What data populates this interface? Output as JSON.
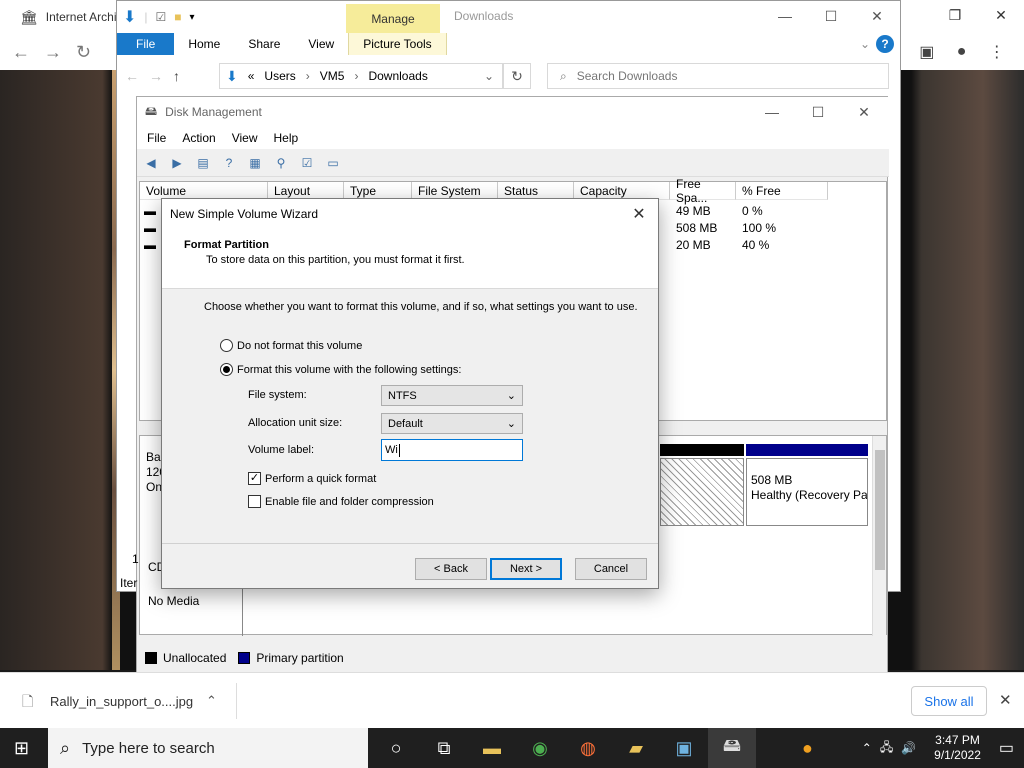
{
  "browser": {
    "tab_title": "Internet Archi",
    "download_file": "Rally_in_support_o....jpg",
    "show_all": "Show all"
  },
  "explorer": {
    "manage_tab": "Manage",
    "title": "Downloads",
    "ribbon_tabs": [
      "File",
      "Home",
      "Share",
      "View",
      "Picture Tools"
    ],
    "breadcrumb": [
      "Users",
      "VM5",
      "Downloads"
    ],
    "breadcrumb_prefix": "«",
    "search_placeholder": "Search Downloads"
  },
  "disk_mgmt": {
    "title": "Disk Management",
    "menu": [
      "File",
      "Action",
      "View",
      "Help"
    ],
    "columns": [
      "Volume",
      "Layout",
      "Type",
      "File System",
      "Status",
      "Capacity",
      "Free Spa...",
      "% Free"
    ],
    "rows": [
      {
        "free": "49 MB",
        "pct": "0 %"
      },
      {
        "free": "508 MB",
        "pct": "100 %"
      },
      {
        "free": "20 MB",
        "pct": "40 %"
      }
    ],
    "disk0_lines": [
      "Bas",
      "120",
      "On"
    ],
    "cd_label": "CD",
    "no_media": "No Media",
    "partial_1": "1",
    "partial_iter": "Iter",
    "recovery_size": "508 MB",
    "recovery_status": "Healthy (Recovery Pa",
    "legend_unallocated": "Unallocated",
    "legend_primary": "Primary partition",
    "colors": {
      "unallocated": "#000000",
      "primary": "#00008b"
    }
  },
  "wizard": {
    "title": "New Simple Volume Wizard",
    "heading": "Format Partition",
    "subheading": "To store data on this partition, you must format it first.",
    "instruction": "Choose whether you want to format this volume, and if so, what settings you want to use.",
    "option_no_format": "Do not format this volume",
    "option_format": "Format this volume with the following settings:",
    "file_system_label": "File system:",
    "file_system_value": "NTFS",
    "alloc_label": "Allocation unit size:",
    "alloc_value": "Default",
    "volume_label_label": "Volume label:",
    "volume_label_value": "Wi",
    "quick_format_label": "Perform a quick format",
    "compression_label": "Enable file and folder compression",
    "back_button": "< Back",
    "next_button": "Next >",
    "cancel_button": "Cancel"
  },
  "taskbar": {
    "search_placeholder": "Type here to search",
    "time": "3:47 PM",
    "date": "9/1/2022"
  }
}
